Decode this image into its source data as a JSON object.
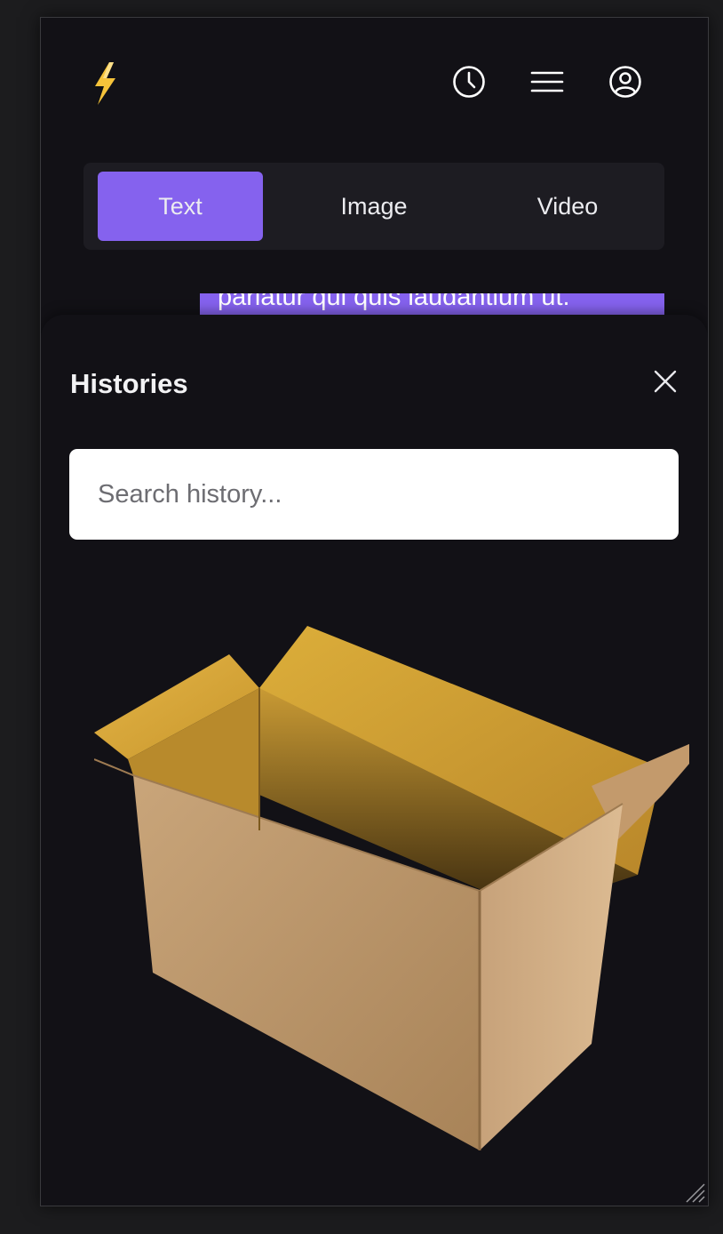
{
  "header": {
    "logo_icon": "lightning-bolt-icon",
    "history_icon": "clock-icon",
    "menu_icon": "hamburger-menu-icon",
    "account_icon": "user-circle-icon"
  },
  "tabs": [
    {
      "label": "Text",
      "active": true
    },
    {
      "label": "Image",
      "active": false
    },
    {
      "label": "Video",
      "active": false
    }
  ],
  "peek_text": "pariatur qui quis laudantium ut.",
  "histories": {
    "title": "Histories",
    "search_placeholder": "Search history...",
    "close_icon": "close-icon",
    "items": [
      {
        "type": "image",
        "subject": "open-cardboard-box"
      }
    ]
  },
  "colors": {
    "accent": "#8562ee",
    "background": "#121116",
    "tab_bar": "#1d1c22"
  }
}
